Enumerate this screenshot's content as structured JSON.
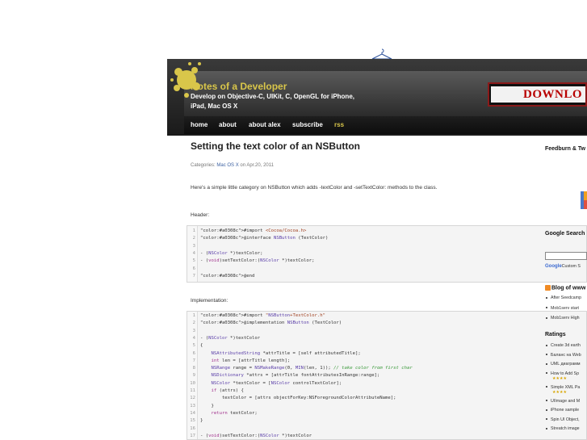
{
  "site": {
    "title": "Notes of a Developer",
    "tagline": "Develop on Objective-C, UIKit, C, OpenGL for iPhone, iPad, Mac OS X",
    "banner_text": "DOWNLO"
  },
  "nav": [
    "home",
    "about",
    "about alex",
    "subscribe",
    "rss"
  ],
  "post": {
    "title": "Setting the text color of an NSButton",
    "meta_prefix": "Categories:",
    "category": "Mac OS X",
    "meta_suffix": "on Apr.20, 2011",
    "intro": "Here's a simple little category on NSButton which adds -textColor and -setTextColor: methods to the class.",
    "header_label": "Header:",
    "implementation_label": "Implementation:"
  },
  "header_code": [
    {
      "n": "1",
      "t": "#import <Cocoa/Cocoa.h>"
    },
    {
      "n": "2",
      "t": "@interface NSButton (TextColor)"
    },
    {
      "n": "3",
      "t": ""
    },
    {
      "n": "4",
      "t": "- (NSColor *)textColor;"
    },
    {
      "n": "5",
      "t": "- (void)setTextColor:(NSColor *)textColor;"
    },
    {
      "n": "6",
      "t": ""
    },
    {
      "n": "7",
      "t": "@end"
    }
  ],
  "impl_code": [
    {
      "n": "1",
      "t": "#import \"NSButton+TextColor.h\""
    },
    {
      "n": "2",
      "t": "@implementation NSButton (TextColor)"
    },
    {
      "n": "3",
      "t": ""
    },
    {
      "n": "4",
      "t": "- (NSColor *)textColor"
    },
    {
      "n": "5",
      "t": "{"
    },
    {
      "n": "6",
      "t": "    NSAttributedString *attrTitle = [self attributedTitle];"
    },
    {
      "n": "7",
      "t": "    int len = [attrTitle length];"
    },
    {
      "n": "8",
      "t": "    NSRange range = NSMakeRange(0, MIN(len, 1)); // take color from first char"
    },
    {
      "n": "9",
      "t": "    NSDictionary *attrs = [attrTitle fontAttributesInRange:range];"
    },
    {
      "n": "10",
      "t": "    NSColor *textColor = [NSColor controlTextColor];"
    },
    {
      "n": "11",
      "t": "    if (attrs) {"
    },
    {
      "n": "12",
      "t": "        textColor = [attrs objectForKey:NSForegroundColorAttributeName];"
    },
    {
      "n": "13",
      "t": "    }"
    },
    {
      "n": "14",
      "t": "    return textColor;"
    },
    {
      "n": "15",
      "t": "}"
    },
    {
      "n": "16",
      "t": ""
    },
    {
      "n": "17",
      "t": "- (void)setTextColor:(NSColor *)textColor"
    }
  ],
  "sidebar": {
    "feedburn": "Feedburn & Tw",
    "google_search": "Google Search",
    "google_custom": "Google",
    "google_custom_suffix": "Custom S",
    "blog_heading": "Blog of www",
    "blog_items": [
      "After Seedcamp",
      "Mob1serv start",
      "Mob1serv High"
    ],
    "ratings_heading": "Ratings",
    "rating_items": [
      {
        "label": "Create 3d earth",
        "stars": ""
      },
      {
        "label": "Баланс на Web",
        "stars": ""
      },
      {
        "label": "UML диаграмм",
        "stars": ""
      },
      {
        "label": "How to Add Sp",
        "stars": "★★★★"
      },
      {
        "label": "Simple XML Pa",
        "stars": "★★★★"
      },
      {
        "label": "UIImage and M",
        "stars": ""
      },
      {
        "label": "iPhone sample",
        "stars": ""
      },
      {
        "label": "Spin UI Object,",
        "stars": ""
      },
      {
        "label": "Streatch image",
        "stars": ""
      }
    ]
  },
  "colors": {
    "title_yellow": "#d9c64a",
    "link_blue": "#3a5fa0",
    "banner_red": "#b80000"
  }
}
